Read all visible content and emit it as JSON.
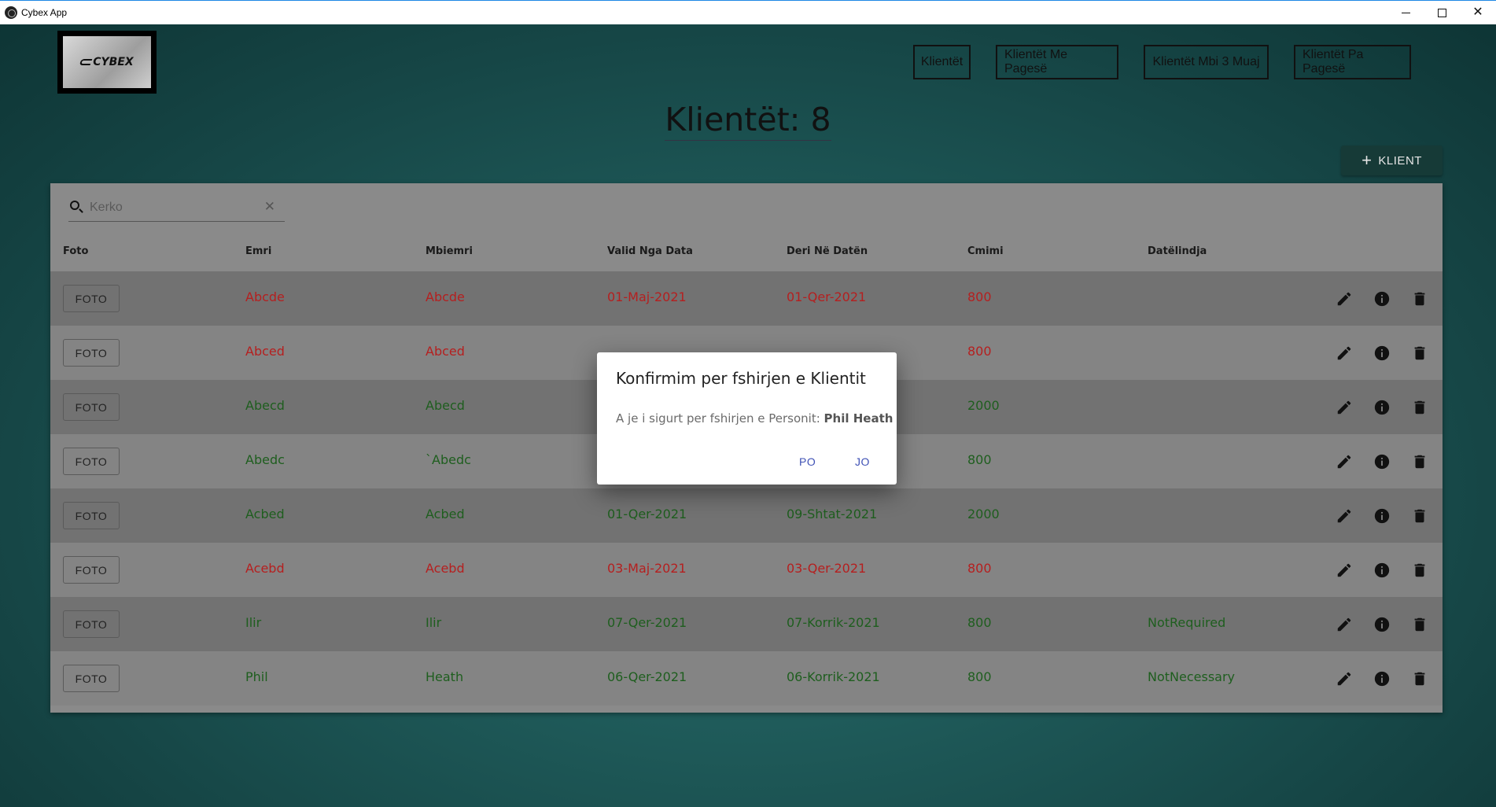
{
  "window": {
    "title": "Cybex App",
    "minimize_icon": "minimize-icon",
    "maximize_icon": "maximize-icon",
    "close_icon": "close-icon",
    "close_glyph": "✕"
  },
  "header": {
    "logo_text": "CYBEX",
    "nav": [
      "Klientët",
      "Klientët Me Pagesë",
      "Klientët Mbi 3 Muaj",
      "Klientët Pa Pagesë"
    ],
    "title": "Klientët: 8",
    "add_button": "KLIENT",
    "add_icon": "plus-icon"
  },
  "search": {
    "placeholder": "Kerko",
    "value": "",
    "clear_glyph": "✕"
  },
  "table": {
    "columns": [
      "Foto",
      "Emri",
      "Mbiemri",
      "Valid Nga Data",
      "Deri Në Datën",
      "Cmimi",
      "Datëlindja"
    ],
    "foto_button": "FOTO",
    "row_icons": [
      "edit-icon",
      "info-icon",
      "delete-icon"
    ],
    "rows": [
      {
        "status": "red",
        "emri": "Abcde",
        "mbiemri": "Abcde",
        "valid": "01-Maj-2021",
        "deri": "01-Qer-2021",
        "cmimi": "800",
        "datelindja": ""
      },
      {
        "status": "red",
        "emri": "Abced",
        "mbiemri": "Abced",
        "valid": "",
        "deri": "",
        "cmimi": "800",
        "datelindja": ""
      },
      {
        "status": "green",
        "emri": "Abecd",
        "mbiemri": "Abecd",
        "valid": "",
        "deri": "",
        "cmimi": "2000",
        "datelindja": ""
      },
      {
        "status": "green",
        "emri": "Abedc",
        "mbiemri": "`Abedc",
        "valid": "",
        "deri": "",
        "cmimi": "800",
        "datelindja": ""
      },
      {
        "status": "green",
        "emri": "Acbed",
        "mbiemri": "Acbed",
        "valid": "01-Qer-2021",
        "deri": "09-Shtat-2021",
        "cmimi": "2000",
        "datelindja": ""
      },
      {
        "status": "red",
        "emri": "Acebd",
        "mbiemri": "Acebd",
        "valid": "03-Maj-2021",
        "deri": "03-Qer-2021",
        "cmimi": "800",
        "datelindja": ""
      },
      {
        "status": "green",
        "emri": "Ilir",
        "mbiemri": "Ilir",
        "valid": "07-Qer-2021",
        "deri": "07-Korrik-2021",
        "cmimi": "800",
        "datelindja": "NotRequired"
      },
      {
        "status": "green",
        "emri": "Phil",
        "mbiemri": "Heath",
        "valid": "06-Qer-2021",
        "deri": "06-Korrik-2021",
        "cmimi": "800",
        "datelindja": "NotNecessary"
      }
    ]
  },
  "dialog": {
    "title": "Konfirmim per fshirjen e Klientit",
    "message": "A je i sigurt per fshirjen e Personit:",
    "person": "Phil Heath",
    "confirm": "PO",
    "cancel": "JO"
  },
  "colors": {
    "expired": "#b51f1f",
    "active": "#1e5e1e",
    "dialog_button": "#3f51b5"
  }
}
